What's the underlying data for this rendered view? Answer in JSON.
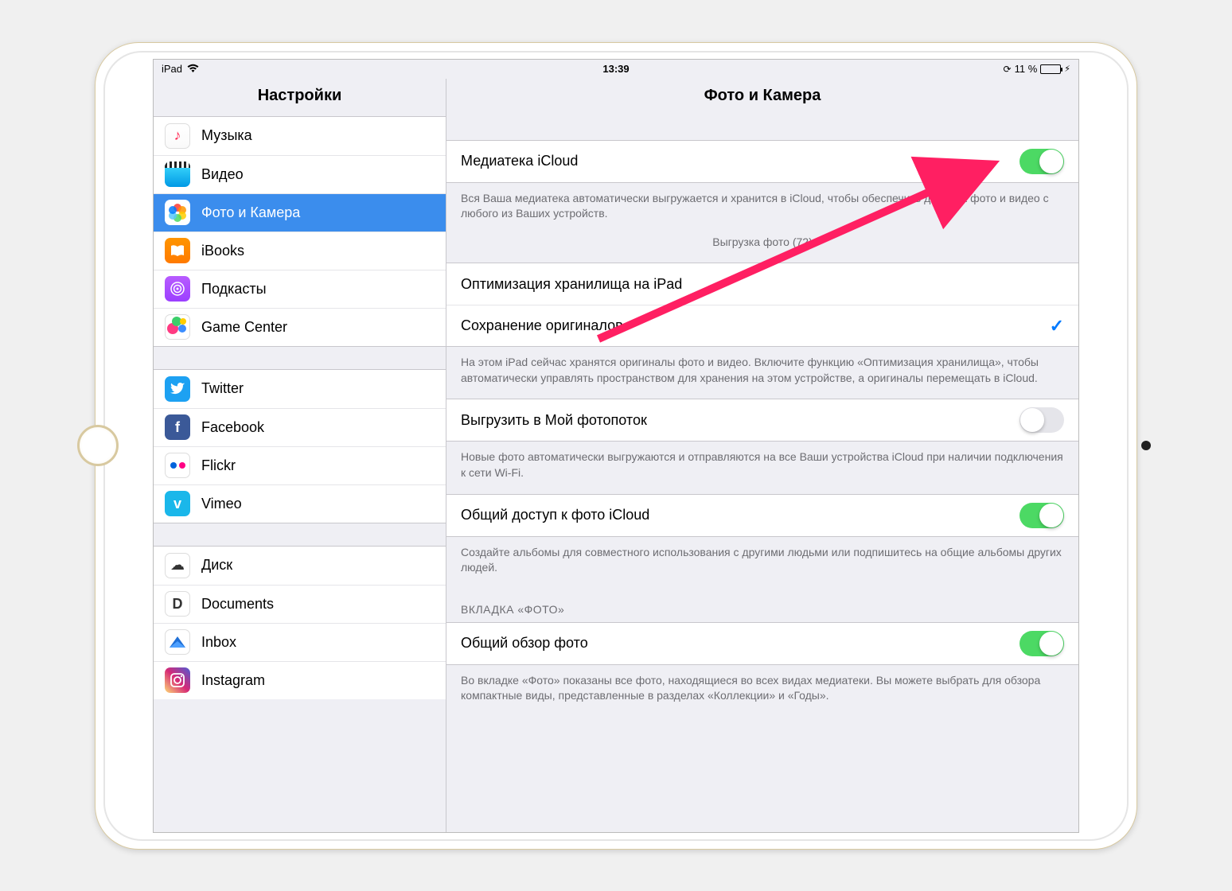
{
  "statusbar": {
    "device": "iPad",
    "time": "13:39",
    "battery_pct": "11 %"
  },
  "sidebar": {
    "title": "Настройки",
    "items": [
      {
        "label": "Музыка"
      },
      {
        "label": "Видео"
      },
      {
        "label": "Фото и Камера"
      },
      {
        "label": "iBooks"
      },
      {
        "label": "Подкасты"
      },
      {
        "label": "Game Center"
      },
      {
        "label": "Twitter"
      },
      {
        "label": "Facebook"
      },
      {
        "label": "Flickr"
      },
      {
        "label": "Vimeo"
      },
      {
        "label": "Диск"
      },
      {
        "label": "Documents"
      },
      {
        "label": "Inbox"
      },
      {
        "label": "Instagram"
      }
    ]
  },
  "main": {
    "title": "Фото и Камера",
    "icloud_library": {
      "label": "Медиатека iCloud",
      "on": true
    },
    "icloud_desc": "Вся Ваша медиатека автоматически выгружается и хранится в iCloud, чтобы обеспечить доступ к фото и видео с любого из Ваших устройств.",
    "uploading": "Выгрузка фото (72)",
    "storage": {
      "optimize": "Оптимизация хранилища на iPad",
      "keep_originals": "Сохранение оригиналов",
      "desc": "На этом iPad сейчас хранятся оригиналы фото и видео. Включите функцию «Оптимизация хранилища», чтобы автоматически управлять пространством для хранения на этом устройстве, а оригиналы перемещать в iCloud."
    },
    "photostream": {
      "label": "Выгрузить в Мой фотопоток",
      "on": false,
      "desc": "Новые фото автоматически выгружаются и отправляются на все Ваши устройства iCloud при наличии подключения к сети Wi-Fi."
    },
    "sharing": {
      "label": "Общий доступ к фото iCloud",
      "on": true,
      "desc": "Создайте альбомы для совместного использования с другими людьми или подпишитесь на общие альбомы других людей."
    },
    "tab_header": "ВКЛАДКА «ФОТО»",
    "summary": {
      "label": "Общий обзор фото",
      "on": true,
      "desc": "Во вкладке «Фото» показаны все фото, находящиеся во всех видах медиатеки. Вы можете выбрать для обзора компактные виды, представленные в разделах «Коллекции» и «Годы»."
    }
  }
}
